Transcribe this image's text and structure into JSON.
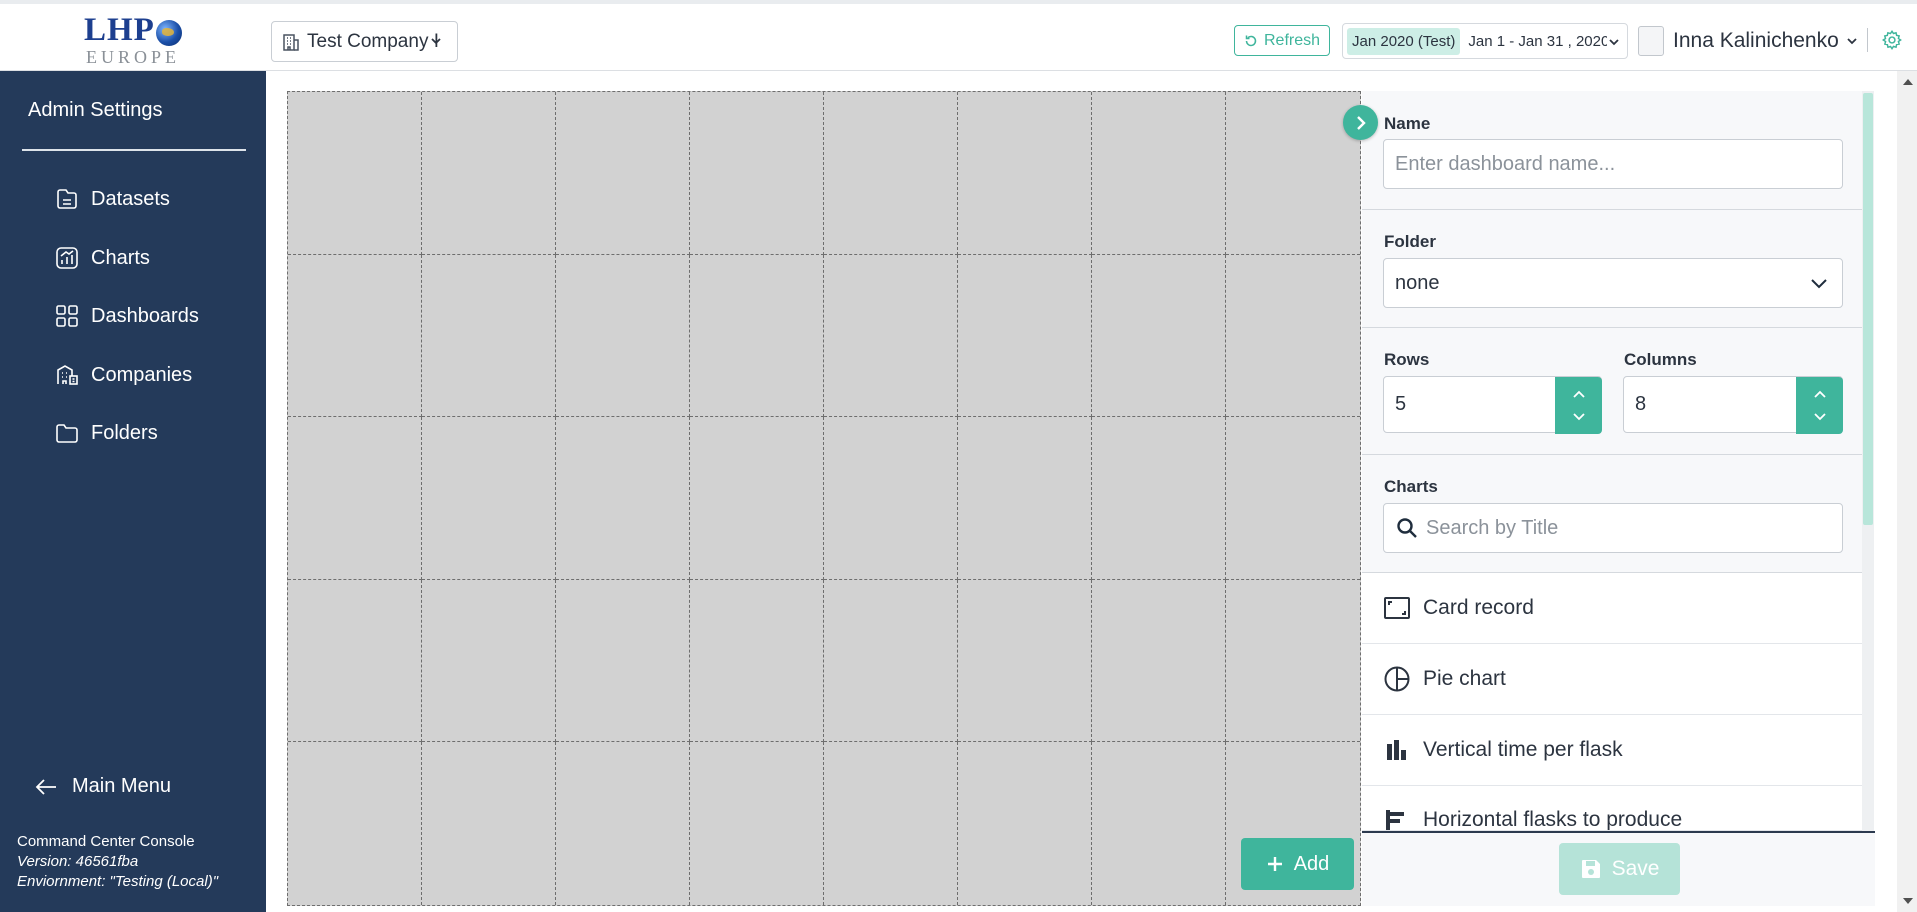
{
  "header": {
    "logo_text_main": "LHP",
    "logo_text_sub": "EUROPE",
    "company_select": {
      "value": "Test Company I",
      "icon": "building-icon"
    },
    "refresh_label": "Refresh",
    "period": {
      "tag": "Jan 2020 (Test)",
      "range": "Jan 1 - Jan 31 , 2020 I"
    },
    "user_name": "Inna Kalinichenko"
  },
  "sidebar": {
    "title": "Admin Settings",
    "items": [
      {
        "label": "Datasets",
        "icon": "dataset-icon"
      },
      {
        "label": "Charts",
        "icon": "chart-icon"
      },
      {
        "label": "Dashboards",
        "icon": "dashboard-icon"
      },
      {
        "label": "Companies",
        "icon": "company-icon"
      },
      {
        "label": "Folders",
        "icon": "folder-icon"
      }
    ],
    "main_menu_label": "Main Menu",
    "meta": {
      "app_name": "Command Center Console",
      "version": "Version: 46561fba",
      "environment": "Enviornment: \"Testing (Local)\""
    }
  },
  "canvas": {
    "rows": 5,
    "columns": 8,
    "add_label": "Add"
  },
  "panel": {
    "name_label": "Name",
    "name_placeholder": "Enter dashboard name...",
    "name_value": "",
    "folder_label": "Folder",
    "folder_value": "none",
    "rows_label": "Rows",
    "rows_value": "5",
    "columns_label": "Columns",
    "columns_value": "8",
    "charts_label": "Charts",
    "search_placeholder": "Search by Title",
    "chart_items": [
      {
        "label": "Card record",
        "icon": "card-icon"
      },
      {
        "label": "Pie chart",
        "icon": "pie-chart-icon"
      },
      {
        "label": "Vertical time per flask",
        "icon": "bar-chart-icon"
      },
      {
        "label": "Horizontal flasks to produce",
        "icon": "horizontal-bar-icon"
      }
    ],
    "save_label": "Save"
  },
  "colors": {
    "accent": "#3fb59c",
    "sidebar_bg": "#243a5a",
    "canvas_bg": "#d2d2d2"
  }
}
